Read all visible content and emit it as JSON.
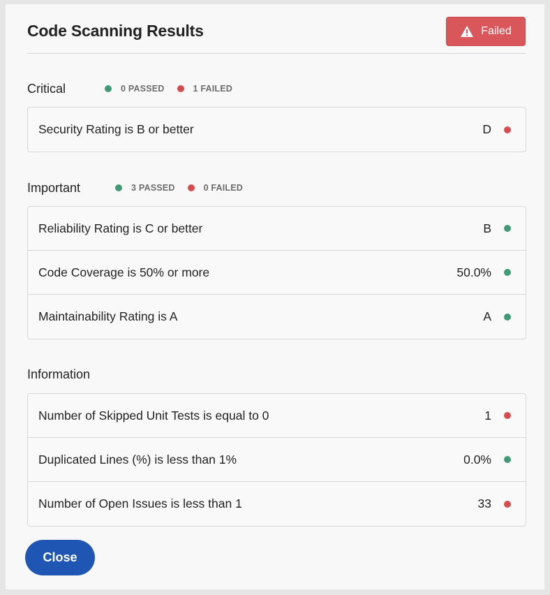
{
  "dialog": {
    "title": "Code Scanning Results",
    "status": {
      "label": "Failed",
      "icon": "warning-icon",
      "color": "#d9575a"
    },
    "close_label": "Close",
    "accent_color": "#1f56b4",
    "pass_color": "#3f9b75",
    "fail_color": "#d64c4f"
  },
  "sections": [
    {
      "title": "Critical",
      "passed_label": "0 PASSED",
      "failed_label": "1 FAILED",
      "rows": [
        {
          "label": "Security Rating is B or better",
          "value": "D",
          "status": "fail"
        }
      ]
    },
    {
      "title": "Important",
      "passed_label": "3 PASSED",
      "failed_label": "0 FAILED",
      "rows": [
        {
          "label": "Reliability Rating is C or better",
          "value": "B",
          "status": "pass"
        },
        {
          "label": "Code Coverage is 50% or more",
          "value": "50.0%",
          "status": "pass"
        },
        {
          "label": "Maintainability Rating is A",
          "value": "A",
          "status": "pass"
        }
      ]
    },
    {
      "title": "Information",
      "rows": [
        {
          "label": "Number of Skipped Unit Tests is equal to 0",
          "value": "1",
          "status": "fail"
        },
        {
          "label": "Duplicated Lines (%) is less than 1%",
          "value": "0.0%",
          "status": "pass"
        },
        {
          "label": "Number of Open Issues is less than 1",
          "value": "33",
          "status": "fail"
        }
      ]
    }
  ]
}
